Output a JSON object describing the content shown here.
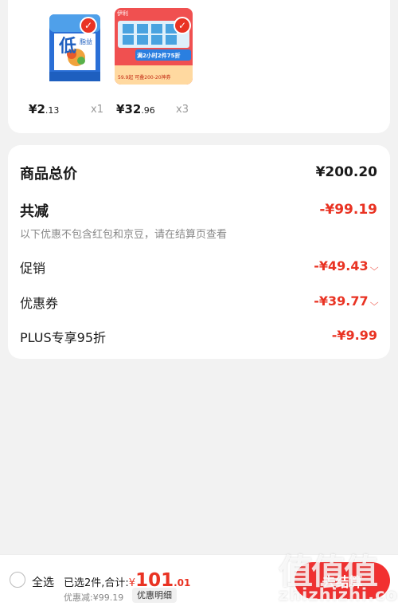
{
  "products": [
    {
      "price_symbol": "¥",
      "price_int": "2",
      "price_dec": ".13",
      "qty": "x1"
    },
    {
      "price_symbol": "¥",
      "price_int": "32",
      "price_dec": ".96",
      "qty": "x3",
      "img_text": {
        "brand": "伊利",
        "banner": "满2小时2件75折",
        "promo": "59.9起 可叠200-20神券"
      }
    }
  ],
  "product1_img": {
    "logo": "低",
    "sub": "脂益"
  },
  "summary": {
    "total_label": "商品总价",
    "total_value": "¥200.20",
    "reduce_label": "共减",
    "reduce_value": "-¥99.19",
    "note": "以下优惠不包含红包和京豆，请在结算页查看",
    "promo_label": "促销",
    "promo_value": "-¥49.43",
    "coupon_label": "优惠券",
    "coupon_value": "-¥39.77",
    "plus_label": "PLUS专享95折",
    "plus_value": "-¥9.99"
  },
  "bottom": {
    "select_all": "全选",
    "selected_text": "已选2件,合计:",
    "pay_symbol": "¥",
    "pay_int": "101",
    "pay_dec": ".01",
    "discount_text": "优惠减:¥99.19",
    "detail_button": "优惠明细",
    "checkout_label": "去结算"
  },
  "watermark": {
    "big": "值值值",
    "small": "zhizhizhi.com"
  },
  "colors": {
    "accent": "#e93323",
    "background": "#f2f2f2"
  }
}
